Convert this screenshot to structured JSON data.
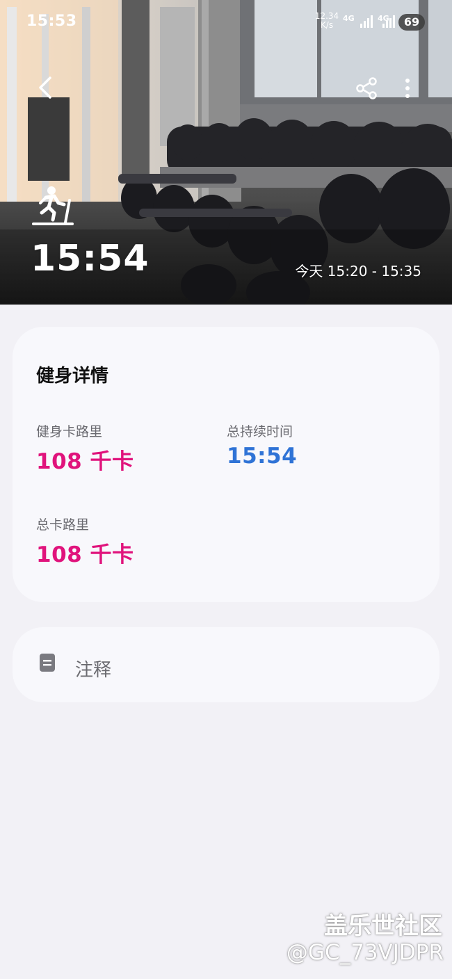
{
  "status_bar": {
    "time": "15:53",
    "net_speed_value": "12.34",
    "net_speed_unit": "K/s",
    "network_1": "4G",
    "network_2": "4G",
    "battery": "69"
  },
  "hero": {
    "icons": [
      "back-icon",
      "share-icon",
      "more-icon",
      "treadmill-running-icon"
    ],
    "total_duration": "15:54",
    "time_range": "今天 15:20 - 15:35"
  },
  "details": {
    "title": "健身详情",
    "metrics": [
      {
        "label": "健身卡路里",
        "value": "108 千卡",
        "color": "#e0137c"
      },
      {
        "label": "总持续时间",
        "value": "15:54",
        "color": "#2f73d6"
      },
      {
        "label": "总卡路里",
        "value": "108 千卡",
        "color": "#e0137c"
      }
    ]
  },
  "notes": {
    "icon": "note-icon",
    "label": "注释"
  },
  "watermark": {
    "line1": "盖乐世社区",
    "line2": "@GC_73VJDPR"
  }
}
